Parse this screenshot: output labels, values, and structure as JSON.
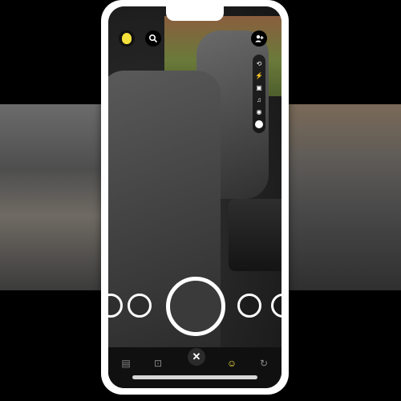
{
  "background": {
    "panels": [
      "left-interior-photo",
      "right-interior-photo"
    ]
  },
  "camera": {
    "top_controls": {
      "profile_icon": "profile-avatar-icon",
      "search_icon": "search-icon",
      "add_friend_icon": "add-friend-icon"
    },
    "tools": [
      "flip-camera-icon",
      "flash-icon",
      "video-icon",
      "music-icon",
      "lens-icon",
      "more-dot-icon"
    ],
    "close_symbol": "✕",
    "nav_icons": [
      "memories-icon",
      "scan-icon",
      "close-icon",
      "smiley-icon",
      "refresh-icon"
    ]
  },
  "colors": {
    "accent_yellow": "#f5e13b",
    "frame": "#ffffff",
    "background": "#000000"
  }
}
